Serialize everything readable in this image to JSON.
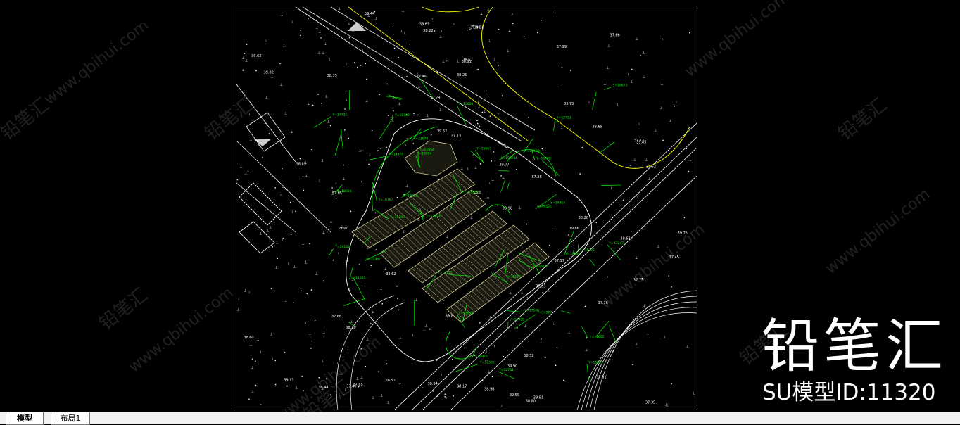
{
  "tabs": [
    {
      "label": "模型",
      "active": true
    },
    {
      "label": "布局1",
      "active": false
    }
  ],
  "watermark": {
    "brand": "铅笔汇",
    "id_text": "SU模型ID:11320",
    "diagonal": "www.qbihui.com"
  },
  "colors": {
    "background": "#000000",
    "lines": "#ffffff",
    "annotations": "#00ff00",
    "road_edge": "#ffff00",
    "hatch": "#d8d0a0"
  }
}
